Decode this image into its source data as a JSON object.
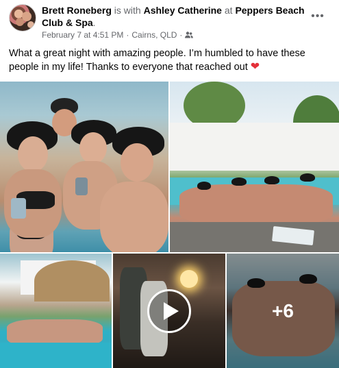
{
  "post": {
    "author": "Brett Roneberg",
    "with_word": "is with",
    "tagged": "Ashley Catherine",
    "at_word": "at",
    "location": "Peppers Beach Club & Spa",
    "period": ".",
    "timestamp": "February 7 at 4:51 PM",
    "separator": "·",
    "place": "Cairns, QLD",
    "separator2": "·",
    "audience_icon": "friends-icon",
    "more_label": "•••",
    "body_text": "What a great night with amazing people. I’m humbled to have these people in my life!  Thanks to everyone that reached out",
    "body_emoji": "❤"
  },
  "photos": {
    "more_count": "+6",
    "video_icon": "play-icon"
  },
  "colors": {
    "text_primary": "#050505",
    "text_secondary": "#65676b",
    "heart": "#e4303a"
  }
}
